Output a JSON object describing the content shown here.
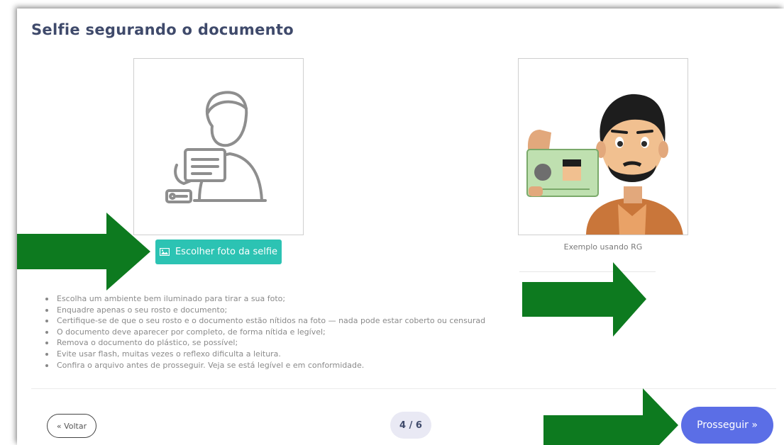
{
  "page": {
    "title": "Selfie segurando o documento"
  },
  "upload": {
    "button_label": "Escolher foto da selfie",
    "placeholder_icon": "person-holding-document-icon"
  },
  "example": {
    "caption": "Exemplo usando RG",
    "image_icon": "man-holding-id-card-illustration"
  },
  "tips": [
    "Escolha um ambiente bem iluminado para tirar a sua foto;",
    "Enquadre apenas o seu rosto e documento;",
    "Certifique-se de que o seu rosto e o documento estão nítidos na foto — nada pode estar coberto ou censurad",
    "O documento deve aparecer por completo, de forma nítida e legível;",
    "Remova o documento do plástico, se possível;",
    "Evite usar flash, muitas vezes o reflexo dificulta a leitura.",
    "Confira o arquivo antes de prosseguir. Veja se está legível e em conformidade."
  ],
  "footer": {
    "back_label": "« Voltar",
    "page_indicator": "4 / 6",
    "next_label": "Prosseguir »"
  },
  "colors": {
    "accent_teal": "#2cc3b3",
    "accent_blue": "#5b6ee6",
    "arrow_green": "#0d7a1f",
    "title_color": "#3f4a6b"
  }
}
